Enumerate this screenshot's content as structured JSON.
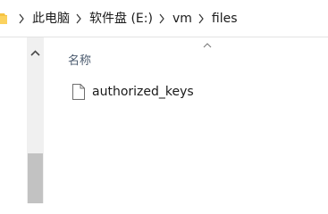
{
  "breadcrumb": {
    "items": [
      "此电脑",
      "软件盘 (E:)",
      "vm",
      "files"
    ]
  },
  "file_list": {
    "column_name": "名称",
    "files": [
      {
        "name": "authorized_keys"
      }
    ]
  },
  "icons": {
    "folder": "folder-icon",
    "separator": "chevron-right-icon",
    "file": "document-icon",
    "sort": "chevron-up-icon",
    "scroll_up": "chevron-up-icon"
  },
  "colors": {
    "folder_yellow": "#f5c342",
    "header_text": "#4a5a6e",
    "scroll_track": "#f0f0f0",
    "scroll_thumb": "#c2c2c2"
  }
}
